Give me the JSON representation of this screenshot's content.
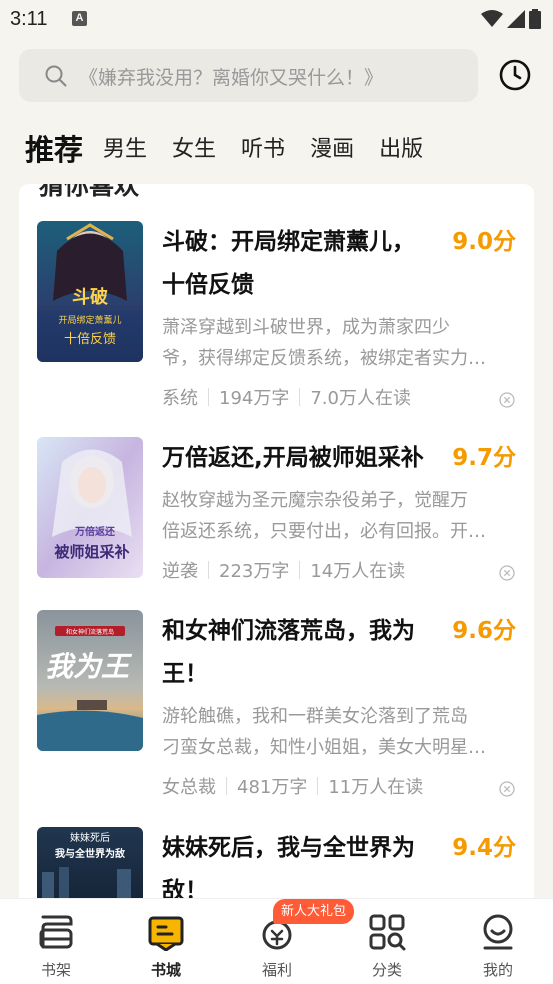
{
  "status_bar": {
    "time": "3:11",
    "notification_letter": "A"
  },
  "search": {
    "placeholder": "《嫌弃我没用？离婚你又哭什么！》"
  },
  "tabs": [
    {
      "label": "推荐",
      "active": true
    },
    {
      "label": "男生"
    },
    {
      "label": "女生"
    },
    {
      "label": "听书"
    },
    {
      "label": "漫画"
    },
    {
      "label": "出版"
    }
  ],
  "section": {
    "title": "猜你喜欢"
  },
  "books": [
    {
      "title_lines": [
        "斗破：开局绑定萧薰儿，",
        "十倍反馈"
      ],
      "score": "9.0分",
      "desc_lines": [
        "萧泽穿越到斗破世界，成为萧家四少",
        "爷，获得绑定反馈系统，被绑定者实力…"
      ],
      "tag": "系统",
      "words": "194万字",
      "readers": "7.0万人在读",
      "cover_text": [
        "斗破",
        "开局绑定萧薰儿",
        "十倍反馈"
      ]
    },
    {
      "title_lines": [
        "万倍返还,开局被师姐采补"
      ],
      "score": "9.7分",
      "desc_lines": [
        "赵牧穿越为圣元魔宗杂役弟子，觉醒万",
        "倍返还系统，只要付出，必有回报。开…"
      ],
      "tag": "逆袭",
      "words": "223万字",
      "readers": "14万人在读",
      "cover_text": [
        "万倍返还",
        "被师姐采补"
      ]
    },
    {
      "title_lines": [
        "和女神们流落荒岛，我为",
        "王！"
      ],
      "score": "9.6分",
      "desc_lines": [
        "游轮触礁，我和一群美女沦落到了荒岛",
        "刁蛮女总裁，知性小姐姐，美女大明星…"
      ],
      "tag": "女总裁",
      "words": "481万字",
      "readers": "11万人在读",
      "cover_text": [
        "和女神们流落荒岛",
        "我为王"
      ]
    },
    {
      "title_lines": [
        "妹妹死后，我与全世界为",
        "敌！"
      ],
      "score": "9.4分",
      "cover_text": [
        "妹妹死后",
        "我与全世界为敌"
      ]
    }
  ],
  "bottom_nav": [
    {
      "label": "书架",
      "icon": "bookshelf-icon"
    },
    {
      "label": "书城",
      "icon": "bookstore-icon",
      "active": true
    },
    {
      "label": "福利",
      "icon": "welfare-icon",
      "badge": "新人大礼包"
    },
    {
      "label": "分类",
      "icon": "category-icon"
    },
    {
      "label": "我的",
      "icon": "profile-icon"
    }
  ],
  "colors": {
    "accent": "#f59a00",
    "badge": "#ff5b36",
    "background": "#f6f4ee"
  }
}
